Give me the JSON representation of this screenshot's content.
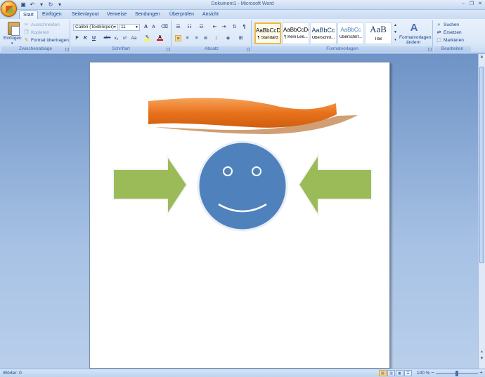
{
  "window": {
    "title": "Dokument1 - Microsoft Word"
  },
  "quick_access": {
    "save_icon": "save-icon",
    "undo_icon": "undo-icon",
    "redo_icon": "redo-icon",
    "customize_icon": "chevron-down-icon"
  },
  "tabs": [
    "Start",
    "Einfügen",
    "Seitenlayout",
    "Verweise",
    "Sendungen",
    "Überprüfen",
    "Ansicht"
  ],
  "ribbon": {
    "clipboard": {
      "paste_label": "Einfügen",
      "cut_label": "Ausschneiden",
      "copy_label": "Kopieren",
      "format_painter_label": "Format übertragen",
      "group_label": "Zwischenablage"
    },
    "font": {
      "font_name": "Calibri (Textkörper)",
      "font_size": "11",
      "grow_label": "A",
      "shrink_label": "A",
      "bold": "F",
      "italic": "K",
      "underline": "U",
      "strikethrough": "abe",
      "subscript": "x₂",
      "superscript": "x²",
      "case": "Aa",
      "group_label": "Schriftart"
    },
    "paragraph": {
      "group_label": "Absatz"
    },
    "styles": {
      "items": [
        {
          "sample": "AaBbCcDc",
          "name": "¶ Standard"
        },
        {
          "sample": "AaBbCcDc",
          "name": "¶ Kein Lee..."
        },
        {
          "sample": "AaBbCc",
          "name": "Überschrif..."
        },
        {
          "sample": "AaBbCc",
          "name": "Überschrif..."
        },
        {
          "sample": "AaB",
          "name": "Titel"
        }
      ],
      "change_label_1": "Formatvorlagen",
      "change_label_2": "ändern",
      "group_label": "Formatvorlagen"
    },
    "editing": {
      "find_label": "Suchen",
      "replace_label": "Ersetzen",
      "select_label": "Markieren",
      "group_label": "Bearbeiten"
    }
  },
  "document": {
    "shapes": [
      "orange-banner",
      "left-arrow",
      "smiley-face",
      "right-arrow"
    ],
    "colors": {
      "banner": "#e8721c",
      "banner_shadow": "#c98e5c",
      "arrow": "#9bbb59",
      "smiley": "#4f81bd"
    }
  },
  "status": {
    "words": "Wörter: 0",
    "zoom": "100 %"
  }
}
